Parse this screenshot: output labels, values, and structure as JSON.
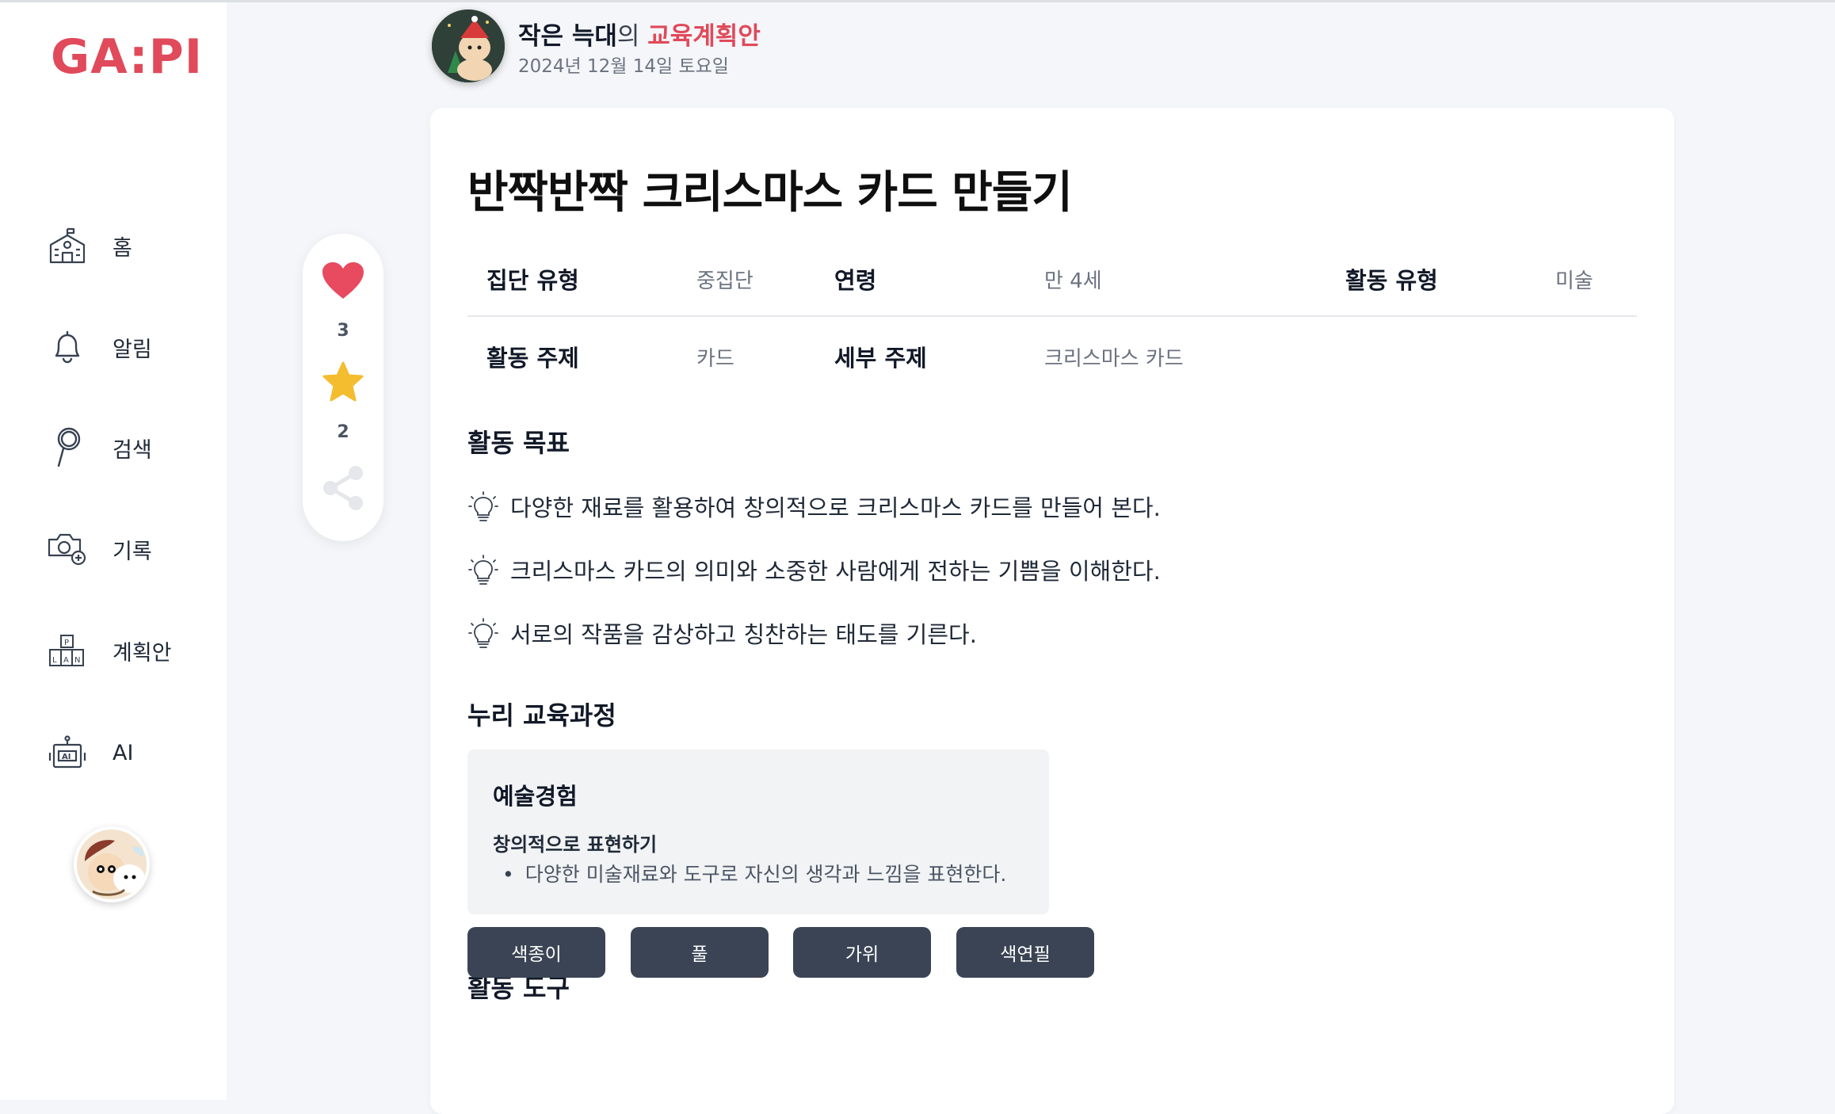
{
  "app": {
    "logo_text": "GA:PI",
    "brand_color": "#e04a5a"
  },
  "sidebar": {
    "items": [
      {
        "label": "홈",
        "icon": "school-house-icon"
      },
      {
        "label": "알림",
        "icon": "bell-icon"
      },
      {
        "label": "검색",
        "icon": "magnifier-icon"
      },
      {
        "label": "기록",
        "icon": "camera-plus-icon"
      },
      {
        "label": "계획안",
        "icon": "plan-blocks-icon"
      },
      {
        "label": "AI",
        "icon": "robot-icon"
      }
    ],
    "avatar_icon": "user-avatar"
  },
  "actions": {
    "like_count": "3",
    "bookmark_count": "2",
    "like_icon": "heart-icon",
    "bookmark_icon": "star-icon",
    "share_icon": "share-icon"
  },
  "post": {
    "author": "작은 늑대",
    "of": "의 ",
    "doc_type": "교육계획안",
    "date": "2024년 12월 14일 토요일",
    "title": "반짝반짝 크리스마스 카드 만들기"
  },
  "meta": {
    "group_type_label": "집단 유형",
    "group_type_value": "중집단",
    "age_label": "연령",
    "age_value": "만 4세",
    "activity_type_label": "활동 유형",
    "activity_type_value": "미술",
    "topic_label": "활동 주제",
    "topic_value": "카드",
    "subtopic_label": "세부 주제",
    "subtopic_value": "크리스마스 카드"
  },
  "goals": {
    "heading": "활동 목표",
    "items": [
      "다양한 재료를 활용하여 창의적으로 크리스마스 카드를 만들어 본다.",
      "크리스마스 카드의 의미와 소중한 사람에게 전하는 기쁨을 이해한다.",
      "서로의 작품을 감상하고 칭찬하는 태도를 기른다."
    ]
  },
  "nuri": {
    "heading": "누리 교육과정",
    "area": "예술경험",
    "sub": "창의적으로 표현하기",
    "item": "다양한 미술재료와 도구로 자신의 생각과 느낌을 표현한다."
  },
  "tools": {
    "heading": "활동 도구",
    "items": [
      "색종이",
      "풀",
      "가위",
      "색연필"
    ]
  }
}
